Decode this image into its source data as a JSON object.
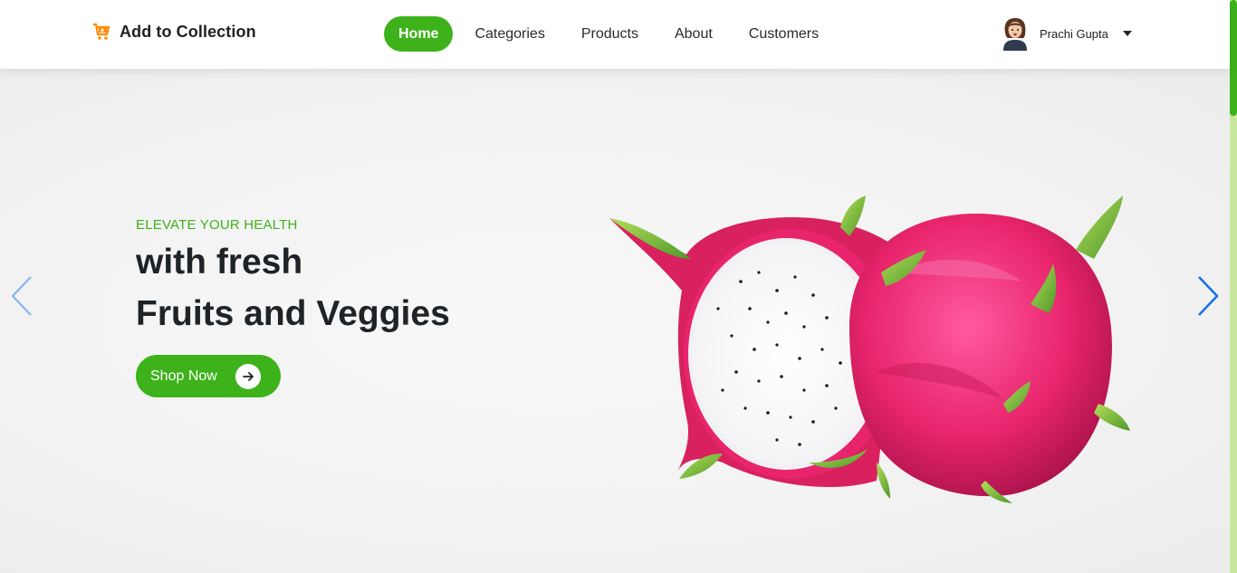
{
  "header": {
    "brand": {
      "name": "Add to Collection",
      "icon": "cart-icon",
      "icon_color": "#ff8a00"
    },
    "nav": [
      {
        "label": "Home",
        "active": true
      },
      {
        "label": "Categories",
        "active": false
      },
      {
        "label": "Products",
        "active": false
      },
      {
        "label": "About",
        "active": false
      },
      {
        "label": "Customers",
        "active": false
      }
    ],
    "user": {
      "name": "Prachi Gupta",
      "avatar": "avatar-icon",
      "menu_icon": "caret-down-icon"
    }
  },
  "hero": {
    "eyebrow": "ELEVATE YOUR HEALTH",
    "headline_line1": "with fresh",
    "headline_line2": "Fruits and Veggies",
    "cta_label": "Shop Now",
    "cta_icon": "arrow-right-icon",
    "image": "dragon-fruit-image",
    "prev_icon": "chevron-left-icon",
    "next_icon": "chevron-right-icon"
  },
  "colors": {
    "accent": "#3db21b",
    "heading": "#1e2328",
    "arrow": "#1a73e8",
    "fruit_pink": "#e8246c"
  }
}
